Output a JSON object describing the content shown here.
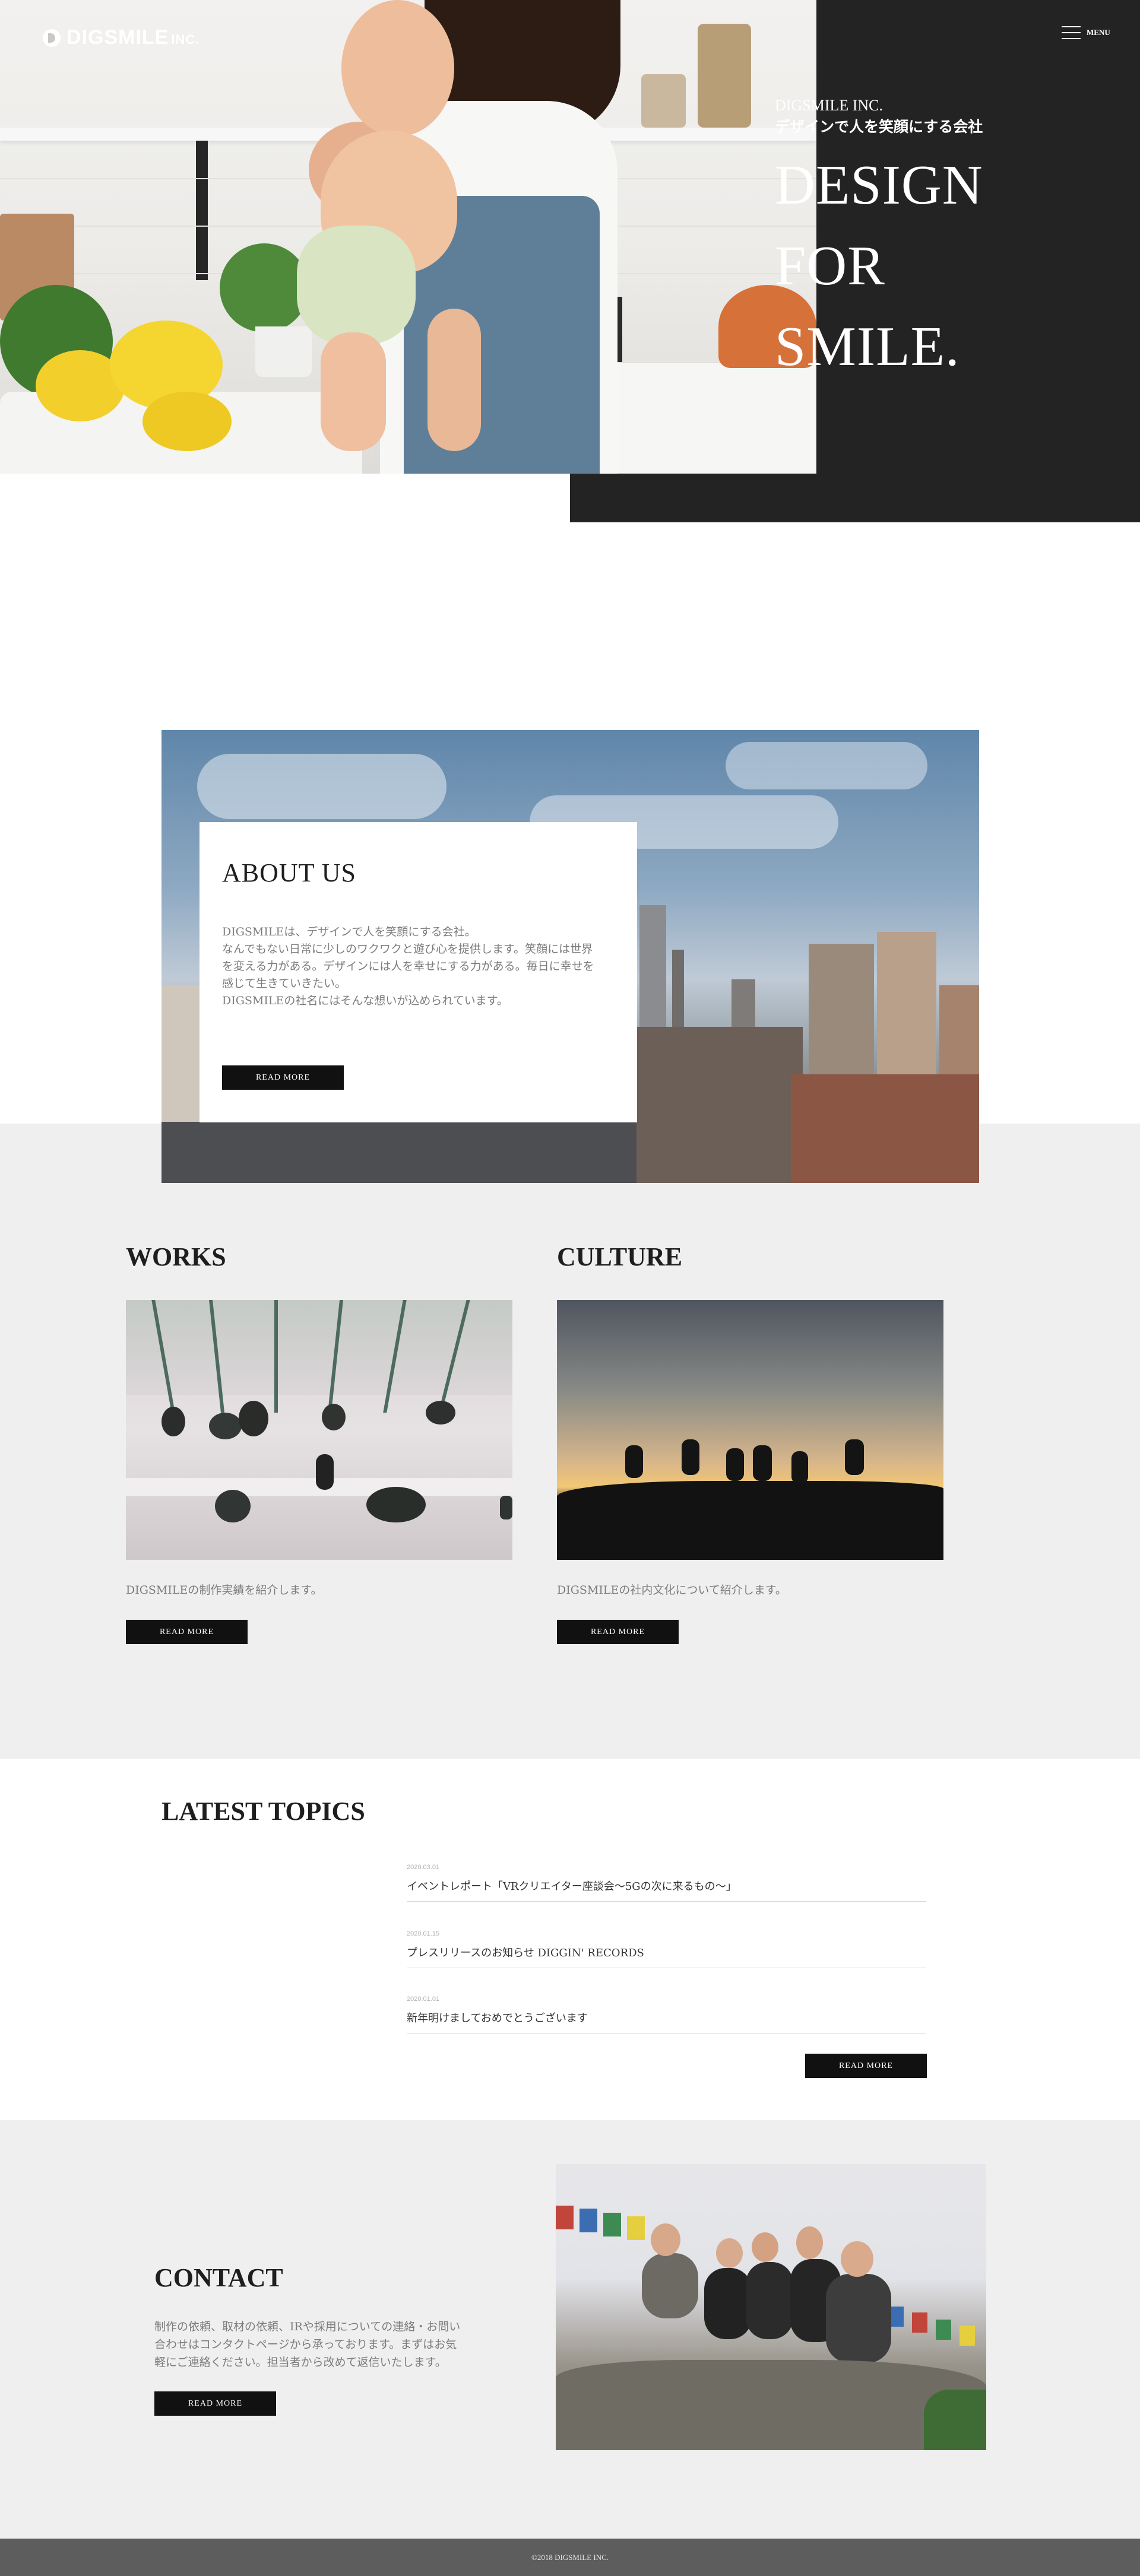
{
  "header": {
    "logo_text": "DIGSMILE",
    "logo_suffix": "INC.",
    "menu_label": "MENU"
  },
  "hero": {
    "company": "DIGSMILE INC.",
    "tagline": "デザインで人を笑顔にする会社",
    "headline_lines": [
      "DESIGN",
      "FOR",
      "SMILE."
    ]
  },
  "about": {
    "title": "ABOUT US",
    "body": "DIGSMILEは、デザインで人を笑顔にする会社。\nなんでもない日常に少しのワクワクと遊び心を提供します。笑顔には世界\nを変える力がある。デザインには人を幸せにする力がある。毎日に幸せを\n感じて生きていきたい。\nDIGSMILEの社名にはそんな想いが込められています。",
    "button": "READ MORE"
  },
  "works": {
    "title": "WORKS",
    "text": "DIGSMILEの制作実績を紹介します。",
    "button": "READ MORE"
  },
  "culture": {
    "title": "CULTURE",
    "text": "DIGSMILEの社内文化について紹介します。",
    "button": "READ MORE"
  },
  "topics": {
    "title": "LATEST TOPICS",
    "items": [
      {
        "date": "2020.03.01",
        "title": "イベントレポート「VRクリエイター座談会〜5Gの次に来るもの〜」"
      },
      {
        "date": "2020.01.15",
        "title": "プレスリリースのお知らせ DIGGIN' RECORDS"
      },
      {
        "date": "2020.01.01",
        "title": "新年明けましておめでとうございます"
      }
    ],
    "button": "READ MORE"
  },
  "contact": {
    "title": "CONTACT",
    "body": "制作の依頼、取材の依頼、IRや採用についての連絡・お問い\n合わせはコンタクトページから承っております。まずはお気\n軽にご連絡ください。担当者から改めて返信いたします。",
    "button": "READ MORE"
  },
  "footer": {
    "copyright": "©2018 DIGSMILE INC."
  }
}
